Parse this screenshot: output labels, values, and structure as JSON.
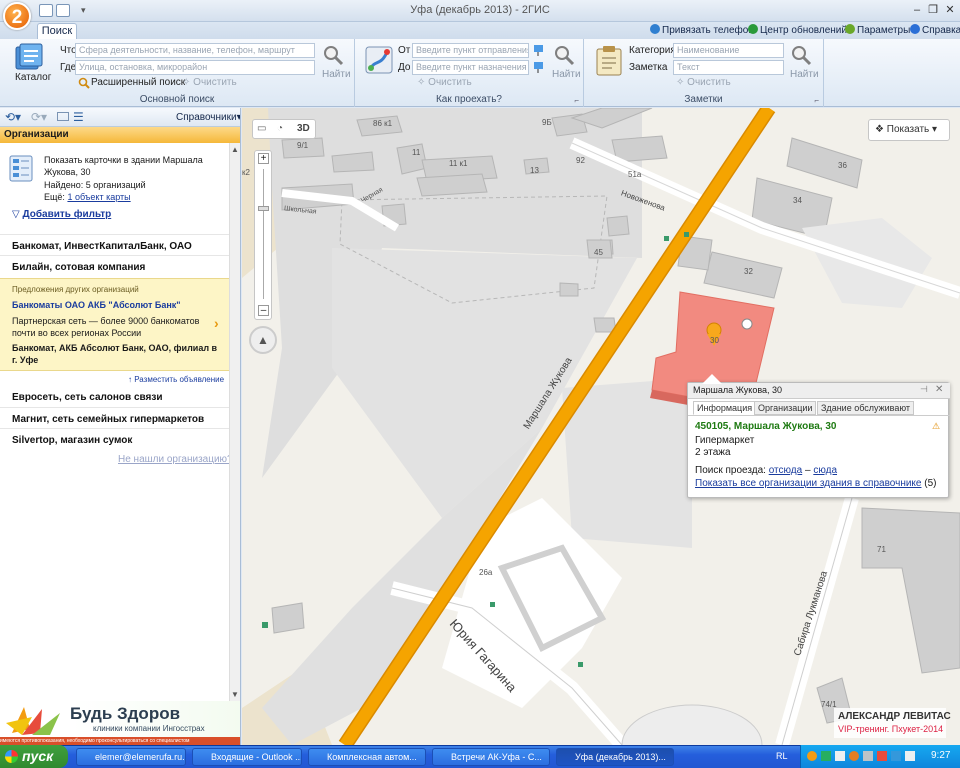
{
  "window": {
    "title": "Уфа (декабрь 2013) - 2ГИС",
    "logo": "2"
  },
  "ribbon": {
    "tab": "Поиск",
    "toplinks": {
      "phone": "Привязать телефон",
      "updates": "Центр обновлений",
      "params": "Параметры",
      "help": "Справка"
    },
    "main": {
      "catalog": "Каталог",
      "what_label": "Что",
      "what_placeholder": "Сфера деятельности, название, телефон, маршрут",
      "where_label": "Где",
      "where_placeholder": "Улица, остановка, микрорайон",
      "advanced": "Расширенный поиск",
      "clear": "Очистить",
      "find": "Найти",
      "group": "Основной поиск"
    },
    "route": {
      "from_label": "От",
      "from_placeholder": "Введите пункт отправления",
      "to_label": "До",
      "to_placeholder": "Введите пункт назначения",
      "clear": "Очистить",
      "find": "Найти",
      "group": "Как проехать?"
    },
    "notes": {
      "category_label": "Категория",
      "category_placeholder": "Наименование",
      "note_label": "Заметка",
      "note_placeholder": "Текст",
      "clear": "Очистить",
      "find": "Найти",
      "group": "Заметки"
    }
  },
  "left": {
    "directories": "Справочники",
    "header": "Организации",
    "info": {
      "line1": "Показать карточки в здании Маршала",
      "line2": "Жукова, 30",
      "found": "Найдено: 5 организаций",
      "also_prefix": "Ещё:",
      "also_link": "1 объект карты",
      "add_filter": "Добавить фильтр"
    },
    "orgs_top": [
      "Банкомат, ИнвестКапиталБанк, ОАО",
      "Билайн, сотовая компания"
    ],
    "ad": {
      "caption": "Предложения других организаций",
      "title": "Банкоматы ОАО АКБ \"Абсолют Банк\"",
      "line1": "Партнерская сеть — более 9000 банкоматов",
      "line2": "почти во всех регионах России",
      "bold1": "Банкомат, АКБ Абсолют Банк, ОАО, филиал в",
      "bold2": "г. Уфе",
      "place_ad": "Разместить объявление"
    },
    "orgs_bottom": [
      "Евросеть, сеть салонов связи",
      "Магнит, сеть семейных гипермаркетов",
      "Silvertop, магазин сумок"
    ],
    "not_found": "Не нашли организацию?",
    "banner": {
      "title": "Будь Здоров",
      "subtitle": "клиники компании Ингосстрах",
      "footer": "имеются противопоказания, необходимо проконсультироваться со специалистом"
    }
  },
  "map": {
    "show_btn": "Показать",
    "btn_3d": "3D",
    "streets": {
      "zhukova": "Маршала Жукова",
      "gagarina": "Юрия Гагарина",
      "lukmanova": "Сабира Лукманова",
      "novochenova": "Новоженова",
      "shkolnaya": "Школьная",
      "chernaya": "Черная"
    },
    "numbers": [
      "86 к1",
      "9/1",
      "11",
      "11 к1",
      "13",
      "9Б",
      "92",
      "51а",
      "36",
      "34",
      "32",
      "45",
      "30",
      "26а",
      "71",
      "74/1",
      "к2"
    ],
    "popup": {
      "header": "Маршала Жукова, 30",
      "tabs": [
        "Информация",
        "Организации",
        "Здание обслуживают"
      ],
      "address": "450105, Маршала Жукова, 30",
      "type": "Гипермаркет",
      "floors": "2 этажа",
      "route_prefix": "Поиск проезда:",
      "from_here": "отсюда",
      "dash": "–",
      "to_here": "сюда",
      "show_all": "Показать все организации здания в справочнике",
      "count": "(5)"
    },
    "watermark": {
      "name": "АЛЕКСАНДР ЛЕВИТАС",
      "tag": "VIP-тренинг. Пхукет-2014"
    }
  },
  "taskbar": {
    "start": "пуск",
    "items": [
      "elemer@elemerufa.ru...",
      "Входящие - Outlook ...",
      "Комплексная автом...",
      "Встречи АК-Уфа - С...",
      "Уфа (декабрь 2013)..."
    ],
    "lang": "RL",
    "time": "9:27"
  },
  "colors": {
    "road": "#f5a400",
    "building_selected": "#f28a80",
    "ribbon_blue": "#15284b",
    "link": "#1a3c9e",
    "green_link": "#1e7a12"
  }
}
